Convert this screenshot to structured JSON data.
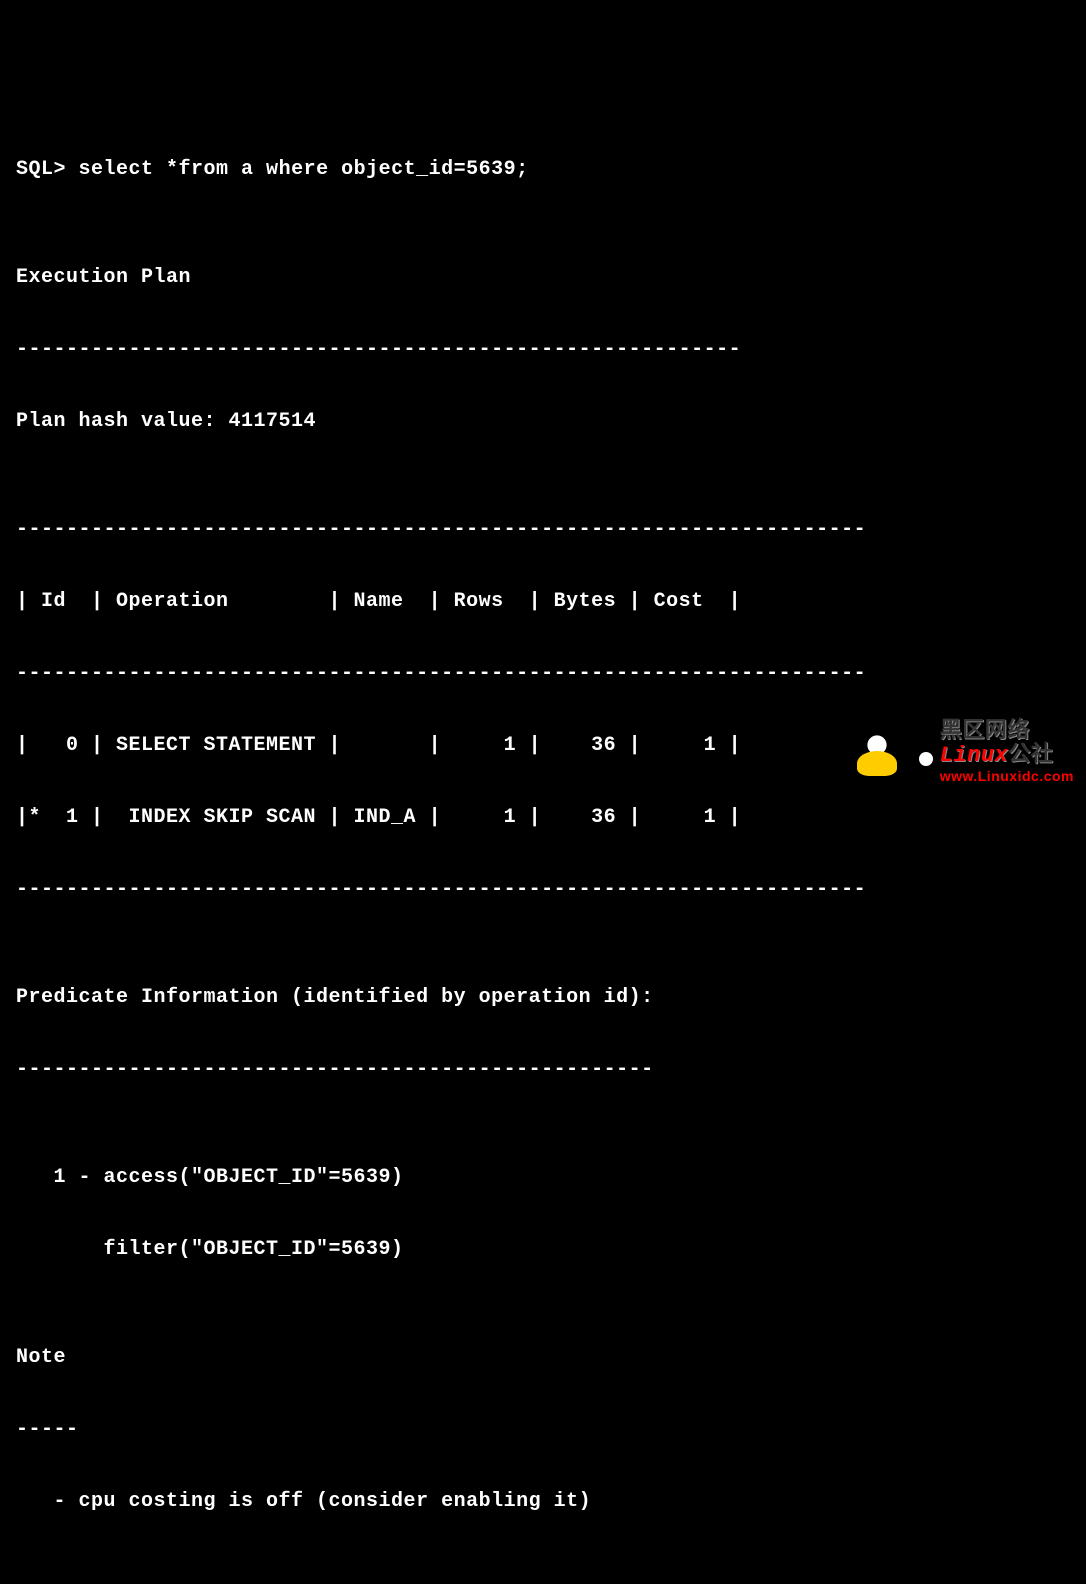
{
  "terminal": {
    "prompt": "SQL>",
    "command": "select *from a where object_id=5639;",
    "blank1": "",
    "exec_plan_title": "Execution Plan",
    "exec_plan_sep": "----------------------------------------------------------",
    "plan_hash": "Plan hash value: 4117514",
    "blank2": "",
    "table_sep": "--------------------------------------------------------------------",
    "table_header": "| Id  | Operation        | Name  | Rows  | Bytes | Cost  |",
    "table_row0": "|   0 | SELECT STATEMENT |       |     1 |    36 |     1 |",
    "table_row1": "|*  1 |  INDEX SKIP SCAN | IND_A |     1 |    36 |     1 |",
    "blank3": "",
    "predicate_title": "Predicate Information (identified by operation id):",
    "predicate_sep": "---------------------------------------------------",
    "blank4": "",
    "predicate_line1": "   1 - access(\"OBJECT_ID\"=5639)",
    "predicate_line2": "       filter(\"OBJECT_ID\"=5639)",
    "blank5": "",
    "note_title": "Note",
    "note_sep": "-----",
    "note_line": "   - cpu costing is off (consider enabling it)"
  },
  "watermark": {
    "cn_part1": "Linux",
    "cn_part2": "公社",
    "prefix": "黑区网络",
    "url": "www.Linuxidc.com"
  },
  "chart_data": {
    "type": "table",
    "title": "Execution Plan",
    "plan_hash_value": 4117514,
    "columns": [
      "Id",
      "Operation",
      "Name",
      "Rows",
      "Bytes",
      "Cost"
    ],
    "rows": [
      {
        "Id": "0",
        "Operation": "SELECT STATEMENT",
        "Name": "",
        "Rows": 1,
        "Bytes": 36,
        "Cost": 1
      },
      {
        "Id": "* 1",
        "Operation": "INDEX SKIP SCAN",
        "Name": "IND_A",
        "Rows": 1,
        "Bytes": 36,
        "Cost": 1
      }
    ],
    "predicate_information": [
      {
        "id": 1,
        "access": "\"OBJECT_ID\"=5639",
        "filter": "\"OBJECT_ID\"=5639"
      }
    ],
    "notes": [
      "cpu costing is off (consider enabling it)"
    ],
    "sql_query": "select *from a where object_id=5639;"
  }
}
